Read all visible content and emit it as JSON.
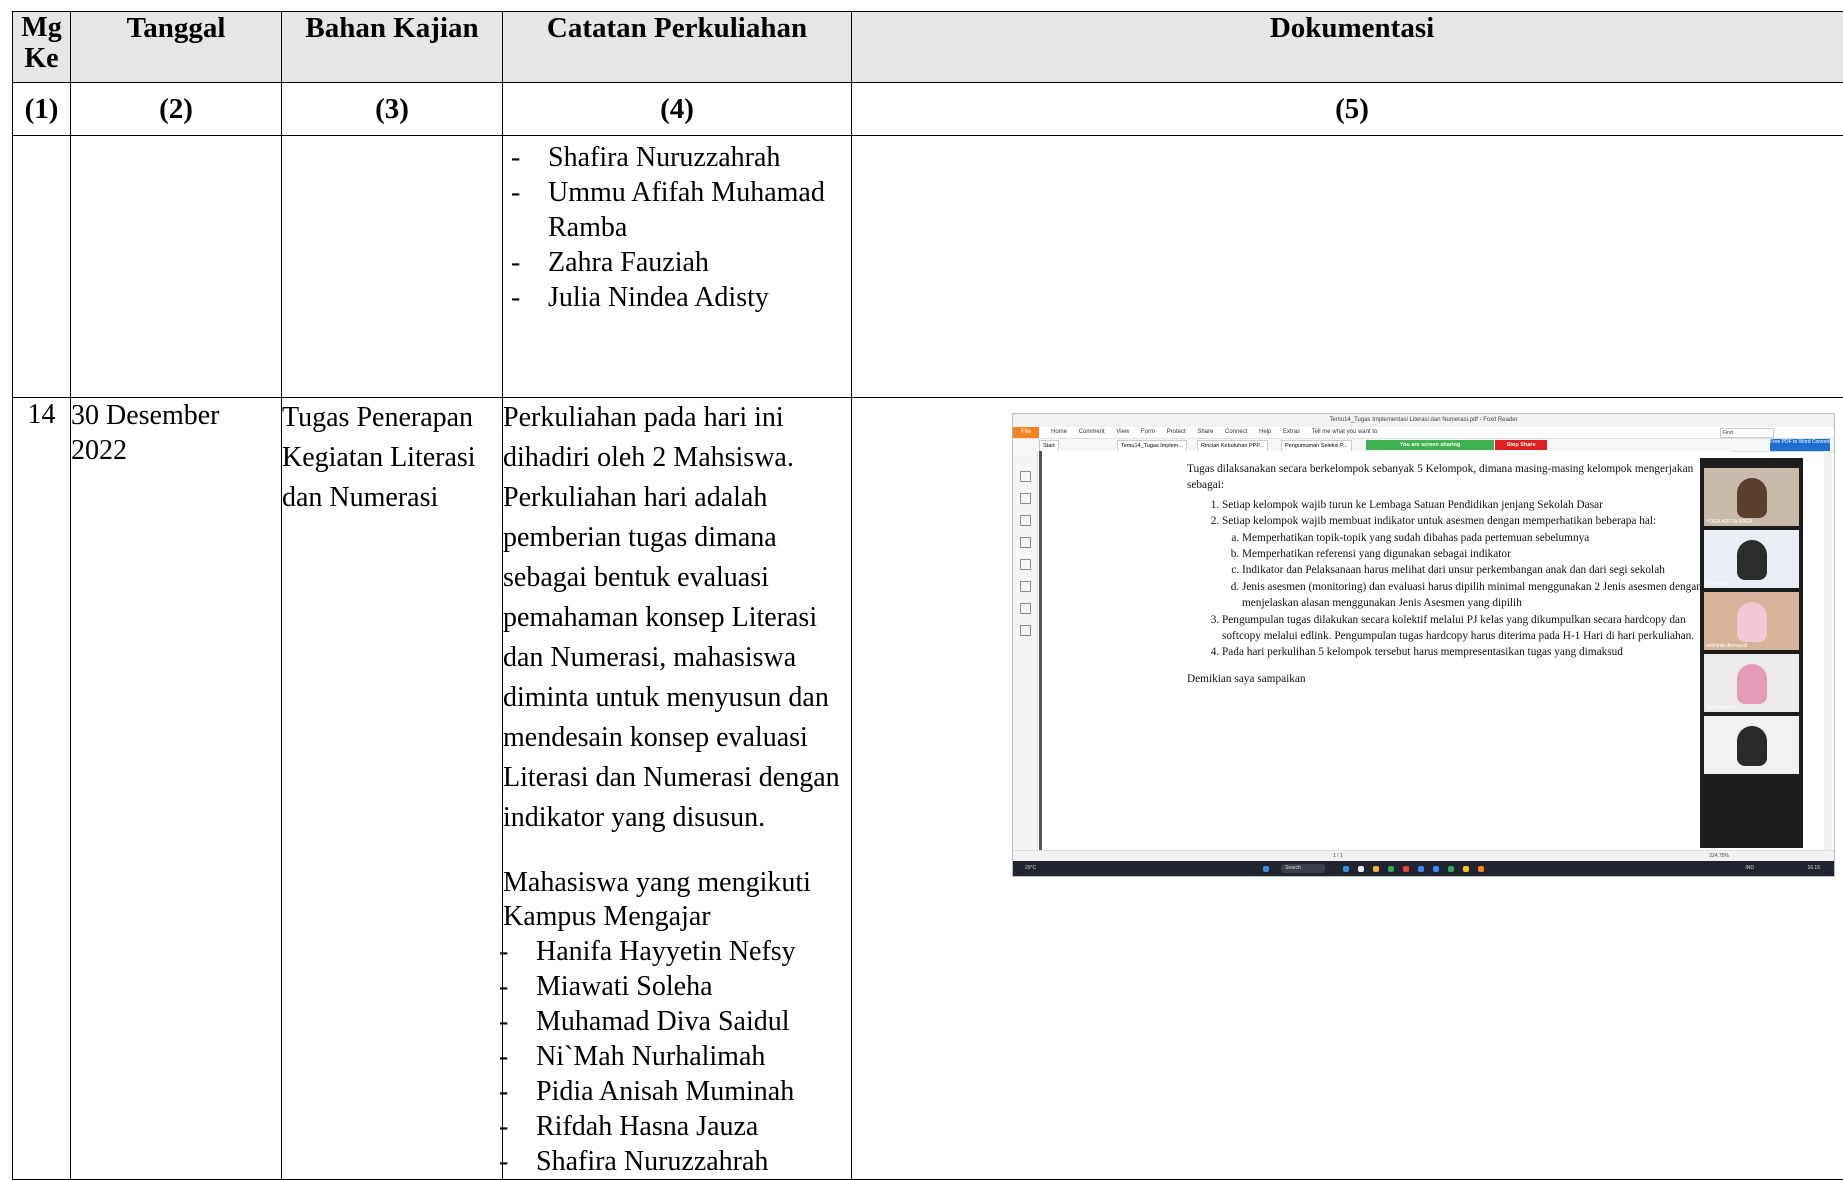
{
  "table": {
    "headers": {
      "mg_ke": "Mg Ke",
      "tanggal": "Tanggal",
      "bahan_kajian": "Bahan Kajian",
      "catatan": "Catatan Perkuliahan",
      "dokumentasi": "Dokumentasi"
    },
    "column_numbers": [
      "(1)",
      "(2)",
      "(3)",
      "(4)",
      "(5)"
    ],
    "continued_row": {
      "students": [
        "Shafira Nuruzzahrah",
        "Ummu Afifah Muhamad Ramba",
        "Zahra Fauziah",
        "Julia Nindea Adisty"
      ]
    },
    "row14": {
      "mg_ke": "14",
      "tanggal": "30 Desember 2022",
      "bahan_kajian": "Tugas Penerapan Kegiatan Literasi dan Numerasi",
      "catatan": "Perkuliahan pada hari ini dihadiri oleh 2 Mahsiswa. Perkuliahan hari adalah pemberian tugas dimana sebagai bentuk evaluasi pemahaman konsep Literasi dan Numerasi, mahasiswa diminta untuk menyusun dan mendesain konsep evaluasi Literasi dan Numerasi dengan indikator yang disusun.",
      "students_heading": "Mahasiswa yang mengikuti Kampus Mengajar",
      "students": [
        "Hanifa Hayyetin Nefsy",
        "Miawati Soleha",
        "Muhamad Diva Saidul",
        "Ni`Mah Nurhalimah",
        "Pidia Anisah Muminah",
        "Rifdah Hasna Jauza",
        "Shafira Nuruzzahrah"
      ]
    }
  },
  "screenshot": {
    "window_title": "Temu14_Tugas Implementasi Literasi dan Numerasi.pdf - Foxit Reader",
    "ribbon": {
      "file": "File",
      "menu": [
        "Home",
        "Comment",
        "View",
        "Form",
        "Protect",
        "Share",
        "Connect",
        "Help",
        "Extras",
        "Tell me what you want to"
      ],
      "find": "Find"
    },
    "tabs": [
      "Start",
      "Temu14_Tugas Implem...",
      "Rincian Kebutuhan PPP...",
      "Pengumuman Seleksi P..."
    ],
    "sharing_text": "You are screen sharing",
    "stop_share": "Stop Share",
    "promo": "Free PDF to Word Converter",
    "doc": {
      "intro": "Tugas dilaksanakan secara berkelompok sebanyak 5 Kelompok, dimana masing-masing kelompok mengerjakan sebagai:",
      "item1": "Setiap kelompok wajib turun ke Lembaga Satuan Pendidikan jenjang Sekolah Dasar",
      "item2": "Setiap kelompok wajib membuat indikator untuk asesmen dengan memperhatikan beberapa hal:",
      "item2_sub": [
        "Memperhatikan topik-topik yang sudah dibahas pada pertemuan sebelumnya",
        "Memperhatikan referensi yang digunakan sebagai indikator",
        "Indikator dan Pelaksanaan harus melihat dari unsur perkembangan anak dan dari segi sekolah",
        "Jenis asesmen (monitoring) dan evaluasi harus dipilih minimal menggunakan 2 Jenis asesmen dengan menjelaskan alasan menggunakan Jenis Asesmen yang dipilih"
      ],
      "item3": "Pengumpulan tugas dilakukan secara kolektif melalui PJ kelas yang dikumpulkan secara hardcopy dan softcopy melalui edlink. Pengumpulan tugas hardcopy harus diterima pada H-1 Hari di hari perkuliahan.",
      "item4": "Pada hari perkulihan 5 kelompok tersebut harus mempresentasikan tugas yang dimaksud",
      "closing": "Demikian saya sampaikan"
    },
    "video_names": [
      "YOGA ADITIA RAGIL",
      "Sri Nabila",
      "reishinta dismayati",
      "Siti Humairoh",
      ""
    ],
    "status": {
      "page": "1 / 1",
      "zoom": "224.75%"
    },
    "taskbar": {
      "weather": "29°C",
      "search": "Search",
      "lang": "IND",
      "time": "16.15"
    }
  }
}
